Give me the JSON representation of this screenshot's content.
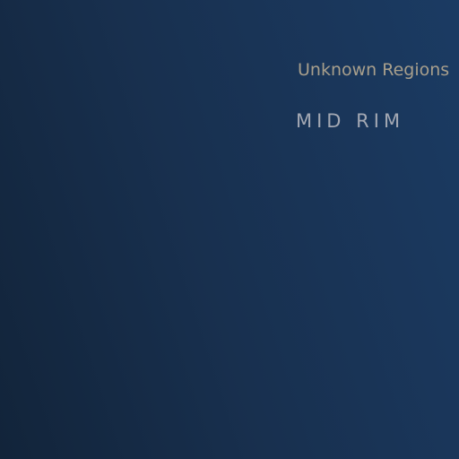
{
  "map": {
    "labels": {
      "region": "Unknown Regions",
      "zone": "MID RIM"
    }
  }
}
